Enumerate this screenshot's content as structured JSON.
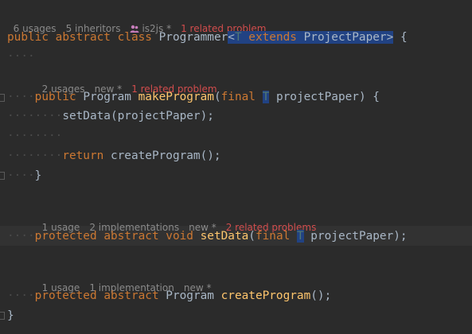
{
  "class_hints": {
    "usages": "6 usages",
    "inheritors": "5 inheritors",
    "author": "is2js *",
    "problems": "1 related problem"
  },
  "class_decl": {
    "kw_public": "public",
    "kw_abstract": "abstract",
    "kw_class": "class",
    "class_name": "Programmer",
    "type_param_open": "<",
    "type_param": "T",
    "kw_extends": "extends",
    "bound": "ProjectPaper",
    "type_param_close": ">",
    "brace_open": "{"
  },
  "method1_hints": {
    "usages": "2 usages",
    "status": "new *",
    "problems": "1 related problem"
  },
  "method1": {
    "kw_public": "public",
    "return_type": "Program",
    "name": "makeProgram",
    "paren_open": "(",
    "kw_final": "final",
    "param_type": "T",
    "param_name": "projectPaper",
    "sig_close": ") {",
    "stmt1_name": "setData",
    "stmt1_args": "(projectPaper);",
    "kw_return": "return",
    "stmt2_name": "createProgram",
    "stmt2_args": "();",
    "brace_close": "}"
  },
  "method2_hints": {
    "usages": "1 usage",
    "implementations": "2 implementations",
    "status": "new *",
    "problems": "2 related problems"
  },
  "method2": {
    "kw_protected": "protected",
    "kw_abstract": "abstract",
    "kw_void": "void",
    "name": "setData",
    "paren_open": "(",
    "kw_final": "final",
    "param_type": "T",
    "param_name": "projectPaper",
    "sig_close": ");"
  },
  "method3_hints": {
    "usages": "1 usage",
    "implementations": "1 implementation",
    "status": "new *"
  },
  "method3": {
    "kw_protected": "protected",
    "kw_abstract": "abstract",
    "return_type": "Program",
    "name": "createProgram",
    "sig_close": "();"
  },
  "class_close": "}",
  "colors": {
    "background": "#2b2b2b",
    "keyword": "#cc7832",
    "method": "#ffc66d",
    "type_param": "#507874",
    "problem": "#d24d4d",
    "selection": "#214283"
  }
}
